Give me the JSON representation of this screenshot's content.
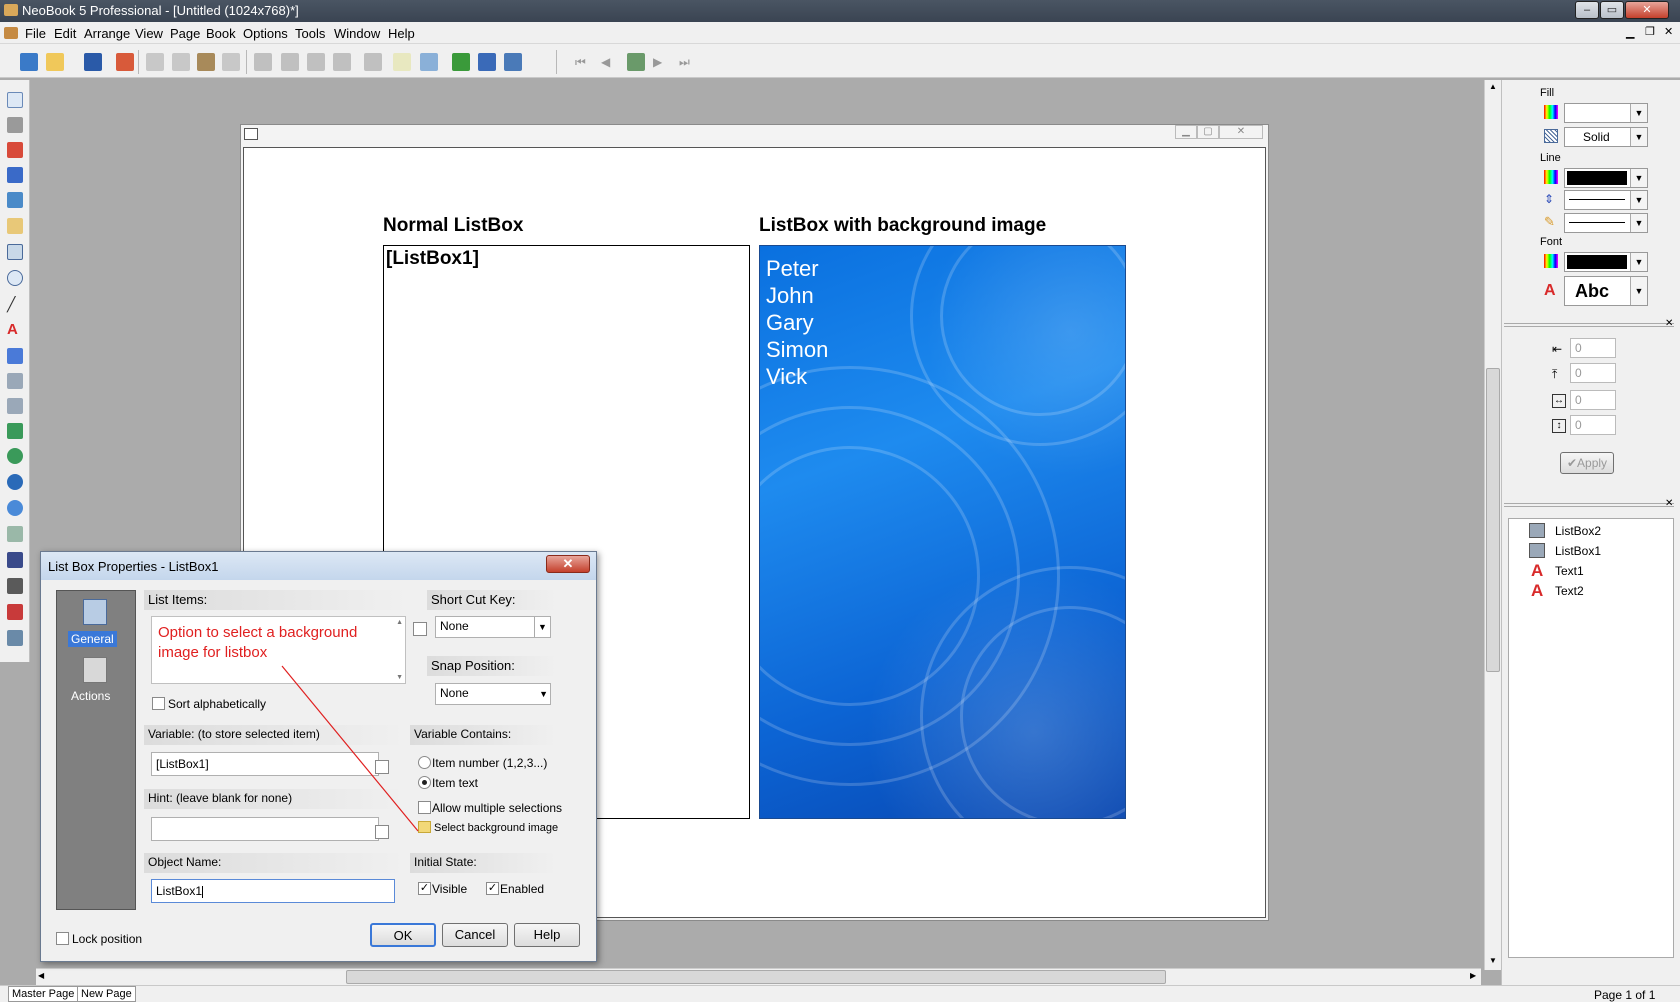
{
  "app": {
    "title": "NeoBook 5 Professional - [Untitled (1024x768)*]"
  },
  "menu": [
    "File",
    "Edit",
    "Arrange",
    "View",
    "Page",
    "Book",
    "Options",
    "Tools",
    "Window",
    "Help"
  ],
  "canvas": {
    "heading_left": "Normal ListBox",
    "heading_right": "ListBox with background image",
    "listbox1_text": "[ListBox1]",
    "listbox2_items": [
      "Peter",
      "John",
      "Gary",
      "Simon",
      "Vick"
    ]
  },
  "right_panel": {
    "fill_label": "Fill",
    "fill_style": "Solid",
    "line_label": "Line",
    "font_label": "Font",
    "font_sample": "Abc",
    "spin_values": [
      "0",
      "0",
      "0",
      "0"
    ],
    "apply_label": "Apply",
    "objects": [
      "ListBox2",
      "ListBox1",
      "Text1",
      "Text2"
    ]
  },
  "dialog": {
    "title": "List Box Properties - ListBox1",
    "side_general": "General",
    "side_actions": "Actions",
    "list_items_label": "List Items:",
    "list_items_text": "Option to select a background image for listbox",
    "sort_label": "Sort alphabetically",
    "shortcut_label": "Short Cut Key:",
    "shortcut_value": "None",
    "snap_label": "Snap Position:",
    "snap_value": "None",
    "variable_label": "Variable: (to store selected item)",
    "variable_value": "[ListBox1]",
    "variable_contains_label": "Variable Contains:",
    "opt_item_number": "Item number (1,2,3...)",
    "opt_item_text": "Item text",
    "allow_multiple": "Allow multiple selections",
    "select_bg": "Select background image",
    "hint_label": "Hint: (leave blank for none)",
    "hint_value": "",
    "object_name_label": "Object Name:",
    "object_name_value": "ListBox1",
    "initial_state_label": "Initial State:",
    "visible_label": "Visible",
    "enabled_label": "Enabled",
    "lock_label": "Lock position",
    "ok": "OK",
    "cancel": "Cancel",
    "help": "Help"
  },
  "status": {
    "tab_master": "Master Page",
    "tab_new": "New Page",
    "page_info": "Page 1 of 1"
  },
  "colors": {
    "accent": "#0a70df",
    "annotation": "#e02020"
  }
}
